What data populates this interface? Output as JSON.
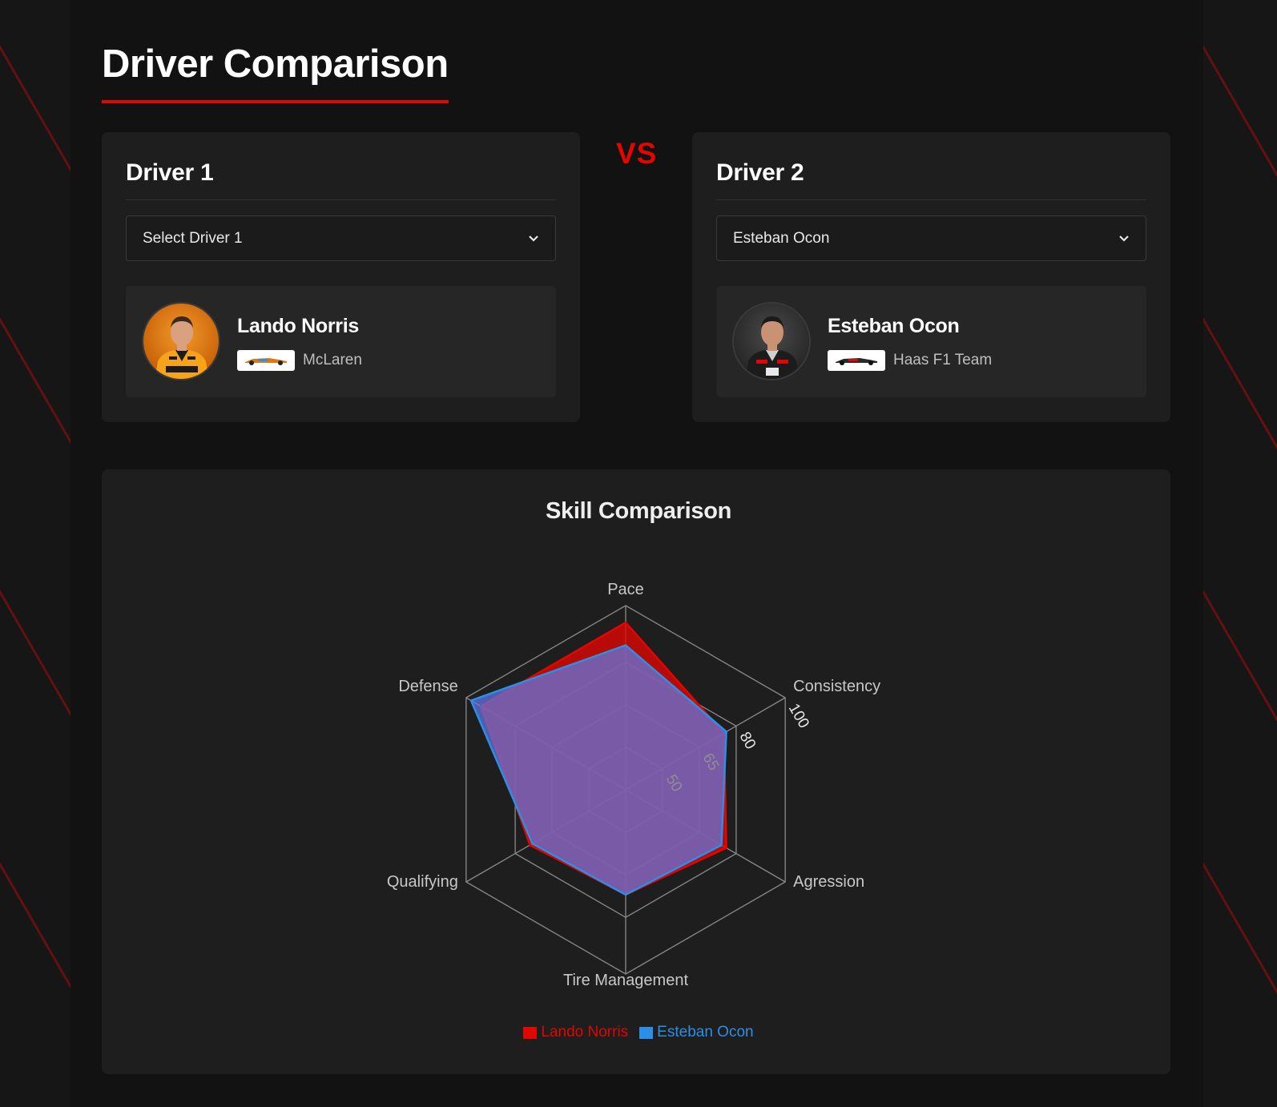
{
  "page": {
    "title": "Driver Comparison",
    "vs_label": "VS"
  },
  "driver1": {
    "heading": "Driver 1",
    "select_value": "Select Driver 1",
    "name": "Lando Norris",
    "team": "McLaren",
    "color": "#e10600"
  },
  "driver2": {
    "heading": "Driver 2",
    "select_value": "Esteban Ocon",
    "name": "Esteban Ocon",
    "team": "Haas F1 Team",
    "color": "#2b8fe6"
  },
  "chart": {
    "title": "Skill Comparison"
  },
  "chart_data": {
    "type": "radar",
    "title": "Skill Comparison",
    "categories": [
      "Pace",
      "Consistency",
      "Agression",
      "Tire Management",
      "Qualifying",
      "Defense"
    ],
    "r_ticks": [
      "50",
      "65",
      "80",
      "100"
    ],
    "r_range": [
      35,
      100
    ],
    "grid": true,
    "legend_position": "bottom",
    "series": [
      {
        "name": "Lando Norris",
        "color": "#e10600",
        "values": [
          94,
          75,
          76,
          72,
          74,
          94
        ]
      },
      {
        "name": "Esteban Ocon",
        "color": "#2b8fe6",
        "values": [
          86,
          76,
          74,
          72,
          73,
          98
        ]
      }
    ]
  }
}
